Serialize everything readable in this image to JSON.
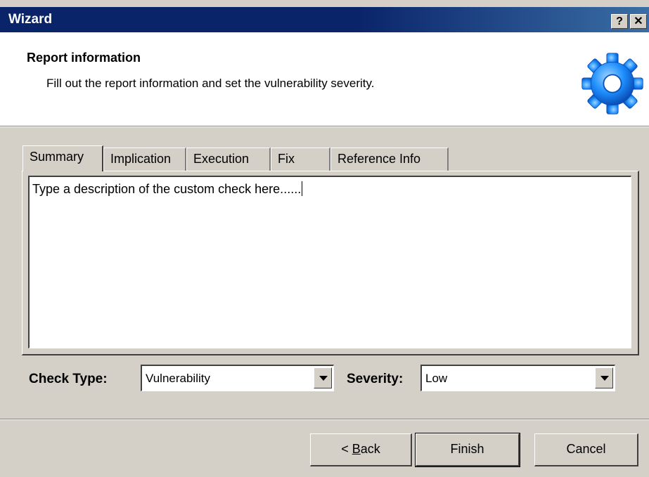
{
  "window": {
    "title": "Wizard",
    "help_glyph": "?",
    "close_glyph": "✕"
  },
  "header": {
    "title": "Report information",
    "subtitle": "Fill out the report information and set the vulnerability severity.",
    "icon": "gear-icon",
    "icon_color": "#1e90ff"
  },
  "tabs": [
    {
      "label": "Summary",
      "active": true
    },
    {
      "label": "Implication",
      "active": false
    },
    {
      "label": "Execution",
      "active": false
    },
    {
      "label": "Fix",
      "active": false
    },
    {
      "label": "Reference Info",
      "active": false
    }
  ],
  "editor": {
    "value": "Type a description of the custom check here......"
  },
  "check_type": {
    "label": "Check Type:",
    "value": "Vulnerability"
  },
  "severity": {
    "label": "Severity:",
    "value": "Low"
  },
  "buttons": {
    "back_prefix": "< ",
    "back_accel": "B",
    "back_rest": "ack",
    "finish": "Finish",
    "cancel": "Cancel"
  }
}
